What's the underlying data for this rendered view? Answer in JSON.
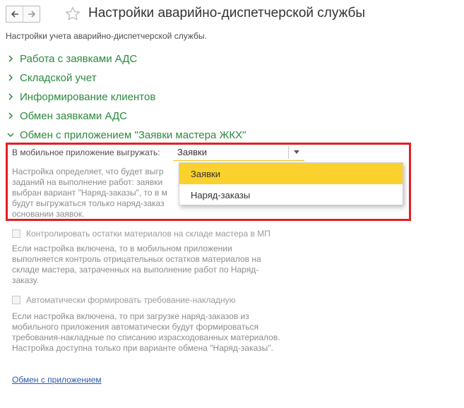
{
  "header": {
    "title": "Настройки аварийно-диспетчерской службы",
    "subtitle": "Настройки учета аварийно-диспетчерской службы.",
    "back_icon": "arrow-left-icon",
    "forward_icon": "arrow-right-icon",
    "favorite_icon": "star-icon"
  },
  "groups": [
    {
      "label": "Работа с заявками АДС",
      "expanded": false
    },
    {
      "label": "Складской учет",
      "expanded": false
    },
    {
      "label": "Информирование клиентов",
      "expanded": false
    },
    {
      "label": "Обмен заявками АДС",
      "expanded": false
    },
    {
      "label": "Обмен с приложением \"Заявки мастера ЖКХ\"",
      "expanded": true
    }
  ],
  "export": {
    "label": "В мобильное приложение выгружать:",
    "value": "Заявки",
    "description_visible": "Настройка определяет, что будет выгр\nзаданий на выполнение работ: заявки\nвыбран вариант \"Наряд-заказы\", то в м\nбудут выгружаться только наряд-заказ\nосновании заявок.",
    "options": [
      "Заявки",
      "Наряд-заказы"
    ],
    "selected_index": 0
  },
  "control_materials": {
    "label": "Контролировать остатки материалов на складе мастера в МП",
    "checked": false,
    "description": "Если настройка включена, то в мобильном приложении выполняется контроль отрицательных остатков материалов на складе мастера, затраченных на выполнение работ по Наряд-заказу."
  },
  "auto_requirement": {
    "label": "Автоматически формировать требование-накладную",
    "checked": false,
    "description": "Если настройка включена, то при загрузке наряд-заказов из мобильного приложения автоматически будут формироваться требования-накладные по списанию израсходованных материалов. Настройка доступна только при варианте обмена \"Наряд-заказы\"."
  },
  "link": {
    "label": "Обмен с приложением"
  },
  "colors": {
    "accent_green": "#2b8a3e",
    "highlight": "#fbd12e",
    "red_frame": "#e31e24"
  }
}
